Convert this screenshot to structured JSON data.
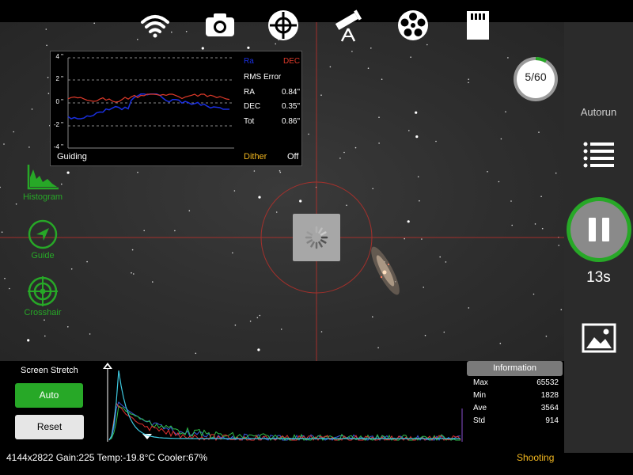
{
  "top_bar": {
    "icons": [
      "wifi-icon",
      "camera-icon",
      "mount-control-icon",
      "telescope-icon",
      "filter-wheel-icon",
      "sd-card-icon"
    ],
    "more_icon": "more-horizontal-icon"
  },
  "guide_panel": {
    "axis_labels": [
      "4 \"",
      "2 \"",
      "0 \"",
      "-2 \"",
      "-4 \""
    ],
    "legend": {
      "ra": "Ra",
      "dec": "DEC"
    },
    "rms_title": "RMS Error",
    "rows": [
      {
        "label": "RA",
        "value": "0.84\""
      },
      {
        "label": "DEC",
        "value": "0.35\""
      },
      {
        "label": "Tot",
        "value": "0.86\""
      }
    ],
    "status": "Guiding",
    "dither_label": "Dither",
    "dither_value": "Off",
    "colors": {
      "ra": "#1a2fe0",
      "dec": "#e03a2a"
    }
  },
  "left_tools": [
    {
      "label": "Histogram",
      "icon": "histogram-icon"
    },
    {
      "label": "Guide",
      "icon": "navigation-arrow-icon"
    },
    {
      "label": "Crosshair",
      "icon": "crosshair-icon"
    }
  ],
  "frame_counter": {
    "text": "5/60",
    "progress_fraction": 0.0833
  },
  "right_panel": {
    "autorun": "Autorun",
    "countdown": "13s",
    "capture_button_icon": "pause-icon",
    "list_icon": "list-icon",
    "gallery_icon": "image-gallery-icon"
  },
  "stretch": {
    "title": "Screen Stretch",
    "auto": "Auto",
    "reset": "Reset"
  },
  "information": {
    "title": "Information",
    "rows": [
      {
        "label": "Max",
        "value": "65532"
      },
      {
        "label": "Min",
        "value": "1828"
      },
      {
        "label": "Ave",
        "value": "3564"
      },
      {
        "label": "Std",
        "value": "914"
      }
    ]
  },
  "status_bar": {
    "text": "4144x2822  Gain:225  Temp:-19.8°C  Cooler:67%",
    "state": "Shooting"
  },
  "colors": {
    "accent_green": "#27a827",
    "status_yellow": "#f2b71f",
    "crosshair_red": "#c0302a"
  }
}
